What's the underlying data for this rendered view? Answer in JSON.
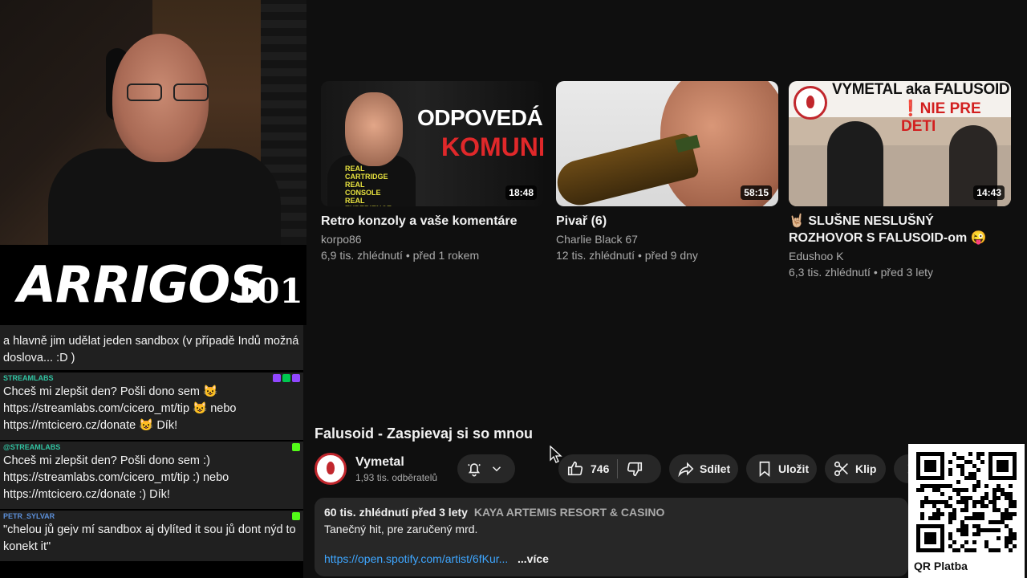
{
  "stream": {
    "brand_logo": "ARRIGOS",
    "brand_number": "101"
  },
  "chat": {
    "messages": [
      {
        "user": "",
        "text": "a hlavně jim udělat jeden sandbox (v případě Indů možná doslova... :D )",
        "user_color": "#ffffff"
      },
      {
        "user": "STREAMLABS",
        "text": "Chceš mi zlepšit den? Pošli dono sem 😺 https://streamlabs.com/cicero_mt/tip 😺 nebo https://mtcicero.cz/donate 😺 Dík!",
        "user_color": "#31c3a2"
      },
      {
        "user": "@STREAMLABS",
        "text": "Chceš mi zlepšit den? Pošli dono sem :) https://streamlabs.com/cicero_mt/tip :) nebo https://mtcicero.cz/donate :) Dík!",
        "user_color": "#31c3a2"
      },
      {
        "user": "PETR_SYLVAR",
        "text": "\"chelou jů gejv mí sandbox aj dylíted it sou jů dont nýd to konekt it\"",
        "user_color": "#5b8fd9"
      }
    ]
  },
  "recommended": [
    {
      "title": "Retro konzoly a vaše komentáre",
      "channel": "korpo86",
      "meta": "6,9 tis. zhlédnutí • před 1 rokem",
      "duration": "18:48",
      "thumb_text_1": "ODPOVEDÁME",
      "thumb_text_2": "KOMUNITE",
      "thumb_shirt": "REAL CARTRIDGE REAL CONSOLE REAL EXPERIENCE"
    },
    {
      "title": "Pivař (6)",
      "channel": "Charlie Black 67",
      "meta": "12 tis. zhlédnutí • před 9 dny",
      "duration": "58:15"
    },
    {
      "title": "🤘🏼 SLUŠNE NESLUŠNÝ ROZHOVOR S FALUSOID-om 😜",
      "channel": "Edushoo K",
      "meta": "6,3 tis. zhlédnutí • před 3 lety",
      "duration": "14:43",
      "thumb_text_1": "VYMETAL aka FALUSOID",
      "thumb_text_2": "❗NIE PRE DETI"
    }
  ],
  "watch": {
    "title": "Falusoid - Zaspievaj si so mnou",
    "channel_name": "Vymetal",
    "subscribers": "1,93 tis. odběratelů",
    "likes": "746",
    "share_label": "Sdílet",
    "save_label": "Uložit",
    "clip_label": "Klip",
    "views_date": "60 tis. zhlédnutí  před 3 lety",
    "location_tag": "KAYA ARTEMIS RESORT & CASINO",
    "description": "Tanečný hit, pre zaručený mrd.",
    "link": "https://open.spotify.com/artist/6fKur...",
    "more_label": "...více"
  },
  "qr": {
    "label": "QR Platba"
  },
  "colors": {
    "page_bg": "#0f0f0f",
    "pill_bg": "#272727",
    "link": "#3ea6ff",
    "brand_red": "#c1272d"
  }
}
